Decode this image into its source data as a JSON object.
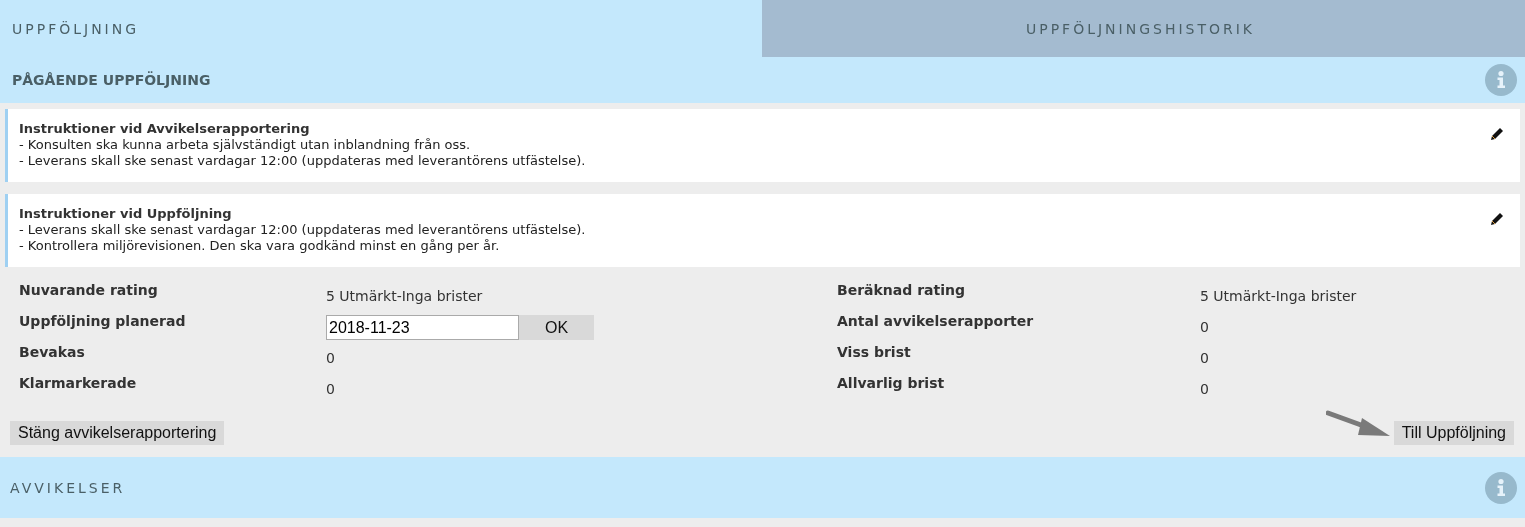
{
  "tabs": [
    {
      "label": "UPPFÖLJNING",
      "selected": true
    },
    {
      "label": "UPPFÖLJNINGSHISTORIK",
      "selected": false
    }
  ],
  "current_section": {
    "title": "PÅGÅENDE UPPFÖLJNING"
  },
  "instructions": [
    {
      "title": "Instruktioner vid Avvikelserapportering",
      "lines": [
        "- Konsulten ska kunna arbeta självständigt utan inblandning från oss.",
        "- Leverans skall ske senast vardagar 12:00 (uppdateras med leverantörens utfästelse)."
      ]
    },
    {
      "title": "Instruktioner vid Uppföljning",
      "lines": [
        "- Leverans skall ske senast vardagar 12:00 (uppdateras med leverantörens utfästelse).",
        "- Kontrollera miljörevisionen. Den ska vara godkänd minst en gång per år."
      ]
    }
  ],
  "stats_left": [
    {
      "kind": "text",
      "label": "Nuvarande rating",
      "value": "5 Utmärkt-Inga brister"
    },
    {
      "kind": "date",
      "label": "Uppföljning planerad",
      "value": "2018-11-23",
      "button": "OK"
    },
    {
      "kind": "text",
      "label": "Bevakas",
      "value": "0"
    },
    {
      "kind": "text",
      "label": "Klarmarkerade",
      "value": "0"
    }
  ],
  "stats_right": [
    {
      "kind": "text",
      "label": "Beräknad rating",
      "value": "5 Utmärkt-Inga brister"
    },
    {
      "kind": "text",
      "label": "Antal avvikelserapporter",
      "value": "0"
    },
    {
      "kind": "text",
      "label": "Viss brist",
      "value": "0"
    },
    {
      "kind": "text",
      "label": "Allvarlig brist",
      "value": "0"
    }
  ],
  "actions": {
    "close_button": "Stäng avvikelserapportering",
    "next_button": "Till Uppföljning"
  },
  "deviations_section": {
    "title": "AVVIKELSER"
  }
}
